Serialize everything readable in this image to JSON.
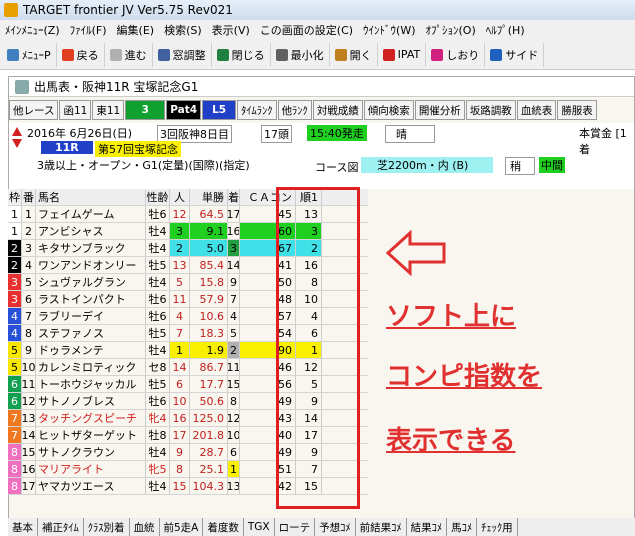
{
  "titlebar": {
    "title": "TARGET frontier JV  Ver5.75  Rev021"
  },
  "menu": [
    "ﾒｲﾝﾒﾆｭｰ(Z)",
    "ﾌｧｲﾙ(F)",
    "編集(E)",
    "検索(S)",
    "表示(V)",
    "この画面の設定(C)",
    "ｳｲﾝﾄﾞｳ(W)",
    "ｵﾌﾟｼｮﾝ(O)",
    "ﾍﾙﾌﾟ(H)"
  ],
  "toolbar": [
    "ﾒﾆｭｰP",
    "戻る",
    "進む",
    "窓調整",
    "閉じる",
    "最小化",
    "開く",
    "IPAT",
    "しおり",
    "サイド"
  ],
  "panel": {
    "title": "出馬表・阪神11R 宝塚記念G1"
  },
  "tabs": [
    "他レース",
    "函11",
    "東11",
    "3",
    "Pat4",
    "L5",
    "ﾀｲﾑﾗﾝｸ",
    "他ﾗﾝｸ",
    "対戦成績",
    "傾向検索",
    "開催分析",
    "坂路調教",
    "血統表",
    "勝服表"
  ],
  "race": {
    "date": "2016年  6月26日(日)",
    "meeting": "3回阪神8日目",
    "runners": "17頭",
    "start": "15:40発走",
    "weather": "晴",
    "prize": "本賞金 [1着",
    "rno": "11R",
    "name": "第57回宝塚記念",
    "cond": "3歳以上・オープン・G1(定量)(国際)(指定)",
    "course_label": "コース図",
    "course": "芝2200m・内 (B)",
    "going": "稍",
    "pace": "中間"
  },
  "columns": [
    "枠",
    "番",
    "馬名",
    "性齢",
    "人",
    "単勝",
    "着",
    "ＣＡコン",
    "順1"
  ],
  "rows": [
    {
      "waku": "1",
      "ban": "1",
      "name": "フェイムゲーム",
      "sex": "牡6",
      "pop": "12",
      "odds": "64.5",
      "ch": "17",
      "ca": "45",
      "rank": "13"
    },
    {
      "waku": "1",
      "ban": "2",
      "name": "アンビシャス",
      "sex": "牡4",
      "pop": "3",
      "odds": "9.1",
      "ch": "16",
      "ca": "60",
      "rank": "3"
    },
    {
      "waku": "2",
      "ban": "3",
      "name": "キタサンブラック",
      "sex": "牡4",
      "pop": "2",
      "odds": "5.0",
      "ch": "3",
      "ca": "67",
      "rank": "2"
    },
    {
      "waku": "2",
      "ban": "4",
      "name": "ワンアンドオンリー",
      "sex": "牡5",
      "pop": "13",
      "odds": "85.4",
      "ch": "14",
      "ca": "41",
      "rank": "16"
    },
    {
      "waku": "3",
      "ban": "5",
      "name": "シュヴァルグラン",
      "sex": "牡4",
      "pop": "5",
      "odds": "15.8",
      "ch": "9",
      "ca": "50",
      "rank": "8"
    },
    {
      "waku": "3",
      "ban": "6",
      "name": "ラストインパクト",
      "sex": "牡6",
      "pop": "11",
      "odds": "57.9",
      "ch": "7",
      "ca": "48",
      "rank": "10"
    },
    {
      "waku": "4",
      "ban": "7",
      "name": "ラブリーデイ",
      "sex": "牡6",
      "pop": "4",
      "odds": "10.6",
      "ch": "4",
      "ca": "57",
      "rank": "4"
    },
    {
      "waku": "4",
      "ban": "8",
      "name": "ステファノス",
      "sex": "牡5",
      "pop": "7",
      "odds": "18.3",
      "ch": "5",
      "ca": "54",
      "rank": "6"
    },
    {
      "waku": "5",
      "ban": "9",
      "name": "ドゥラメンテ",
      "sex": "牡4",
      "pop": "1",
      "odds": "1.9",
      "ch": "2",
      "ca": "90",
      "rank": "1"
    },
    {
      "waku": "5",
      "ban": "10",
      "name": "カレンミロティック",
      "sex": "セ8",
      "pop": "14",
      "odds": "86.7",
      "ch": "11",
      "ca": "46",
      "rank": "12"
    },
    {
      "waku": "6",
      "ban": "11",
      "name": "トーホウジャッカル",
      "sex": "牡5",
      "pop": "6",
      "odds": "17.7",
      "ch": "15",
      "ca": "56",
      "rank": "5"
    },
    {
      "waku": "6",
      "ban": "12",
      "name": "サトノノブレス",
      "sex": "牡6",
      "pop": "10",
      "odds": "50.6",
      "ch": "8",
      "ca": "49",
      "rank": "9"
    },
    {
      "waku": "7",
      "ban": "13",
      "name": "タッチングスピーチ",
      "sex": "牝4",
      "pop": "16",
      "odds": "125.0",
      "ch": "12",
      "ca": "43",
      "rank": "14"
    },
    {
      "waku": "7",
      "ban": "14",
      "name": "ヒットザターゲット",
      "sex": "牡8",
      "pop": "17",
      "odds": "201.8",
      "ch": "10",
      "ca": "40",
      "rank": "17"
    },
    {
      "waku": "8",
      "ban": "15",
      "name": "サトノクラウン",
      "sex": "牡4",
      "pop": "9",
      "odds": "28.7",
      "ch": "6",
      "ca": "49",
      "rank": "9"
    },
    {
      "waku": "8",
      "ban": "16",
      "name": "マリアライト",
      "sex": "牝5",
      "pop": "8",
      "odds": "25.1",
      "ch": "1",
      "ca": "51",
      "rank": "7"
    },
    {
      "waku": "8",
      "ban": "17",
      "name": "ヤマカツエース",
      "sex": "牡4",
      "pop": "15",
      "odds": "104.3",
      "ch": "13",
      "ca": "42",
      "rank": "15"
    }
  ],
  "annotation": [
    "ソフト上に",
    "コンピ指数を",
    "表示できる"
  ],
  "bottomtabs": [
    "基本",
    "補正ﾀｲﾑ",
    "ｸﾗｽ別着",
    "血統",
    "前5走A",
    "着度数",
    "TGX",
    "ローテ",
    "予想ｺﾒ",
    "前結果ｺﾒ",
    "結果ｺﾒ",
    "馬ｺﾒ",
    "ﾁｪｯｸ用"
  ],
  "colors": {
    "waku": {
      "1": "#ffffff",
      "2": "#000000",
      "3": "#e83030",
      "4": "#2850d8",
      "5": "#f8e800",
      "6": "#10a050",
      "7": "#f07820",
      "8": "#f070c0"
    },
    "highlight_green": "#20d020",
    "highlight_cyan": "#40e0e8",
    "highlight_yellow": "#f8f000",
    "accent_red": "#e03030"
  }
}
